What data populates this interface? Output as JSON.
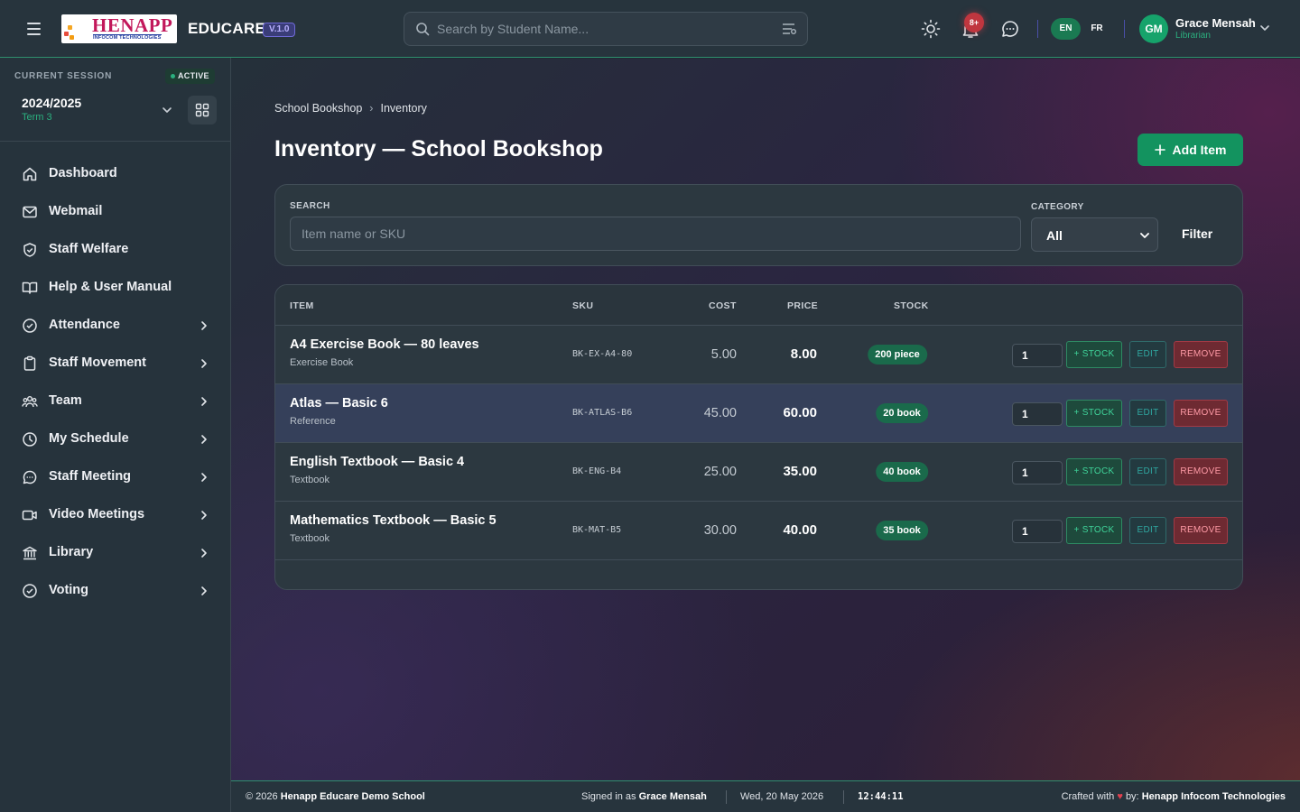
{
  "header": {
    "logo_text": "HENAPP",
    "logo_subtext": "INFOCOM TECHNOLOGIES",
    "app_name": "EDUCARE",
    "version": "V.1.0",
    "search_placeholder": "Search by Student Name...",
    "notification_count": "8+",
    "languages": [
      "EN",
      "FR"
    ],
    "active_language": "EN",
    "user": {
      "initials": "GM",
      "name": "Grace Mensah",
      "role": "Librarian"
    }
  },
  "sidebar": {
    "session_label": "CURRENT SESSION",
    "session_status": "ACTIVE",
    "session_year": "2024/2025",
    "session_term": "Term 3",
    "items": [
      {
        "label": "Dashboard",
        "icon": "home-icon",
        "has_children": false
      },
      {
        "label": "Webmail",
        "icon": "mail-icon",
        "has_children": false
      },
      {
        "label": "Staff Welfare",
        "icon": "shield-icon",
        "has_children": false
      },
      {
        "label": "Help & User Manual",
        "icon": "book-icon",
        "has_children": false
      },
      {
        "label": "Attendance",
        "icon": "check-circle-icon",
        "has_children": true
      },
      {
        "label": "Staff Movement",
        "icon": "clipboard-icon",
        "has_children": true
      },
      {
        "label": "Team",
        "icon": "users-icon",
        "has_children": true
      },
      {
        "label": "My Schedule",
        "icon": "clock-icon",
        "has_children": true
      },
      {
        "label": "Staff Meeting",
        "icon": "chat-icon",
        "has_children": true
      },
      {
        "label": "Video Meetings",
        "icon": "video-icon",
        "has_children": true
      },
      {
        "label": "Library",
        "icon": "library-icon",
        "has_children": true
      },
      {
        "label": "Voting",
        "icon": "check-circle-icon",
        "has_children": true
      }
    ]
  },
  "main": {
    "breadcrumb": [
      "School Bookshop",
      "Inventory"
    ],
    "title": "Inventory — School Bookshop",
    "add_button": "Add Item",
    "filter": {
      "search_label": "SEARCH",
      "search_placeholder": "Item name or SKU",
      "category_label": "CATEGORY",
      "category_value": "All",
      "filter_button": "Filter"
    },
    "table": {
      "columns": [
        "ITEM",
        "SKU",
        "COST",
        "PRICE",
        "STOCK"
      ],
      "rows": [
        {
          "name": "A4 Exercise Book — 80 leaves",
          "category": "Exercise Book",
          "sku": "BK-EX-A4-80",
          "cost": "5.00",
          "price": "8.00",
          "stock": "200 piece",
          "qty": "1",
          "highlighted": false
        },
        {
          "name": "Atlas — Basic 6",
          "category": "Reference",
          "sku": "BK-ATLAS-B6",
          "cost": "45.00",
          "price": "60.00",
          "stock": "20 book",
          "qty": "1",
          "highlighted": true
        },
        {
          "name": "English Textbook — Basic 4",
          "category": "Textbook",
          "sku": "BK-ENG-B4",
          "cost": "25.00",
          "price": "35.00",
          "stock": "40 book",
          "qty": "1",
          "highlighted": false
        },
        {
          "name": "Mathematics Textbook — Basic 5",
          "category": "Textbook",
          "sku": "BK-MAT-B5",
          "cost": "30.00",
          "price": "40.00",
          "stock": "35 book",
          "qty": "1",
          "highlighted": false
        }
      ],
      "actions": {
        "stock": "+ STOCK",
        "edit": "EDIT",
        "remove": "REMOVE"
      }
    }
  },
  "footer": {
    "copyright": "© 2026",
    "school": "Henapp Educare Demo School",
    "signed_in_prefix": "Signed in as",
    "signed_in_user": "Grace Mensah",
    "date": "Wed, 20 May 2026",
    "time": "12:44:11",
    "crafted_prefix": "Crafted with",
    "crafted_by": "by:",
    "company": "Henapp Infocom Technologies"
  },
  "colors": {
    "accent": "#13935f",
    "brand_pink": "#c2185b",
    "danger": "#c0363f"
  }
}
